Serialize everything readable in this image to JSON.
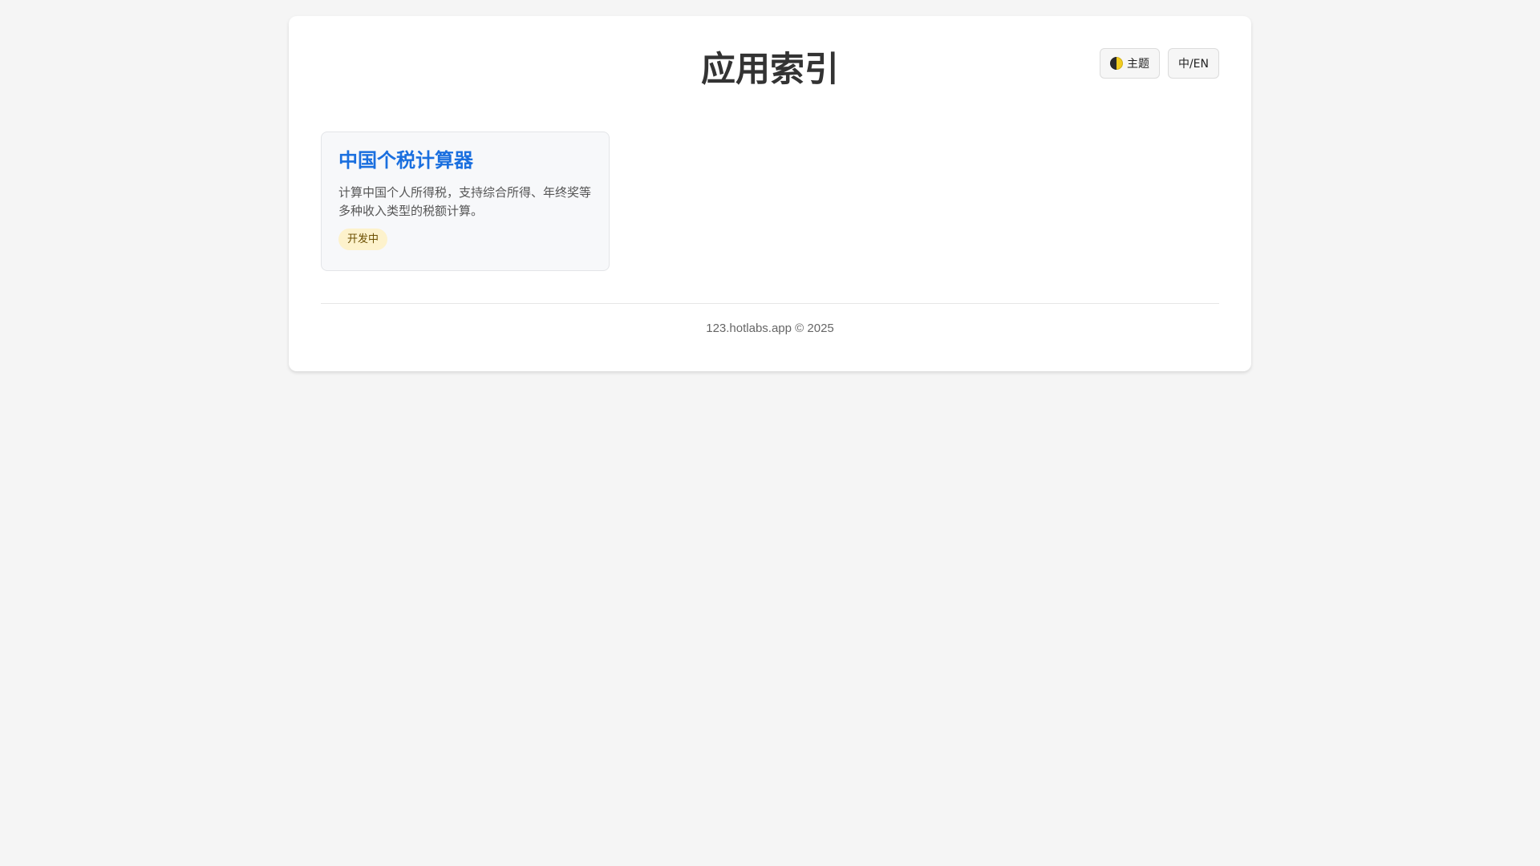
{
  "header": {
    "title": "应用索引",
    "theme_button_label": "主题",
    "theme_icon": "half-moon-icon",
    "lang_button_label": "中/EN"
  },
  "apps": [
    {
      "title": "中国个税计算器",
      "description": "计算中国个人所得税，支持综合所得、年终奖等多种收入类型的税额计算。",
      "status": "开发中"
    }
  ],
  "footer": {
    "text": "123.hotlabs.app © 2025"
  },
  "colors": {
    "page_background": "#f5f5f5",
    "card_background": "#ffffff",
    "app_title": "#1a6fdf",
    "badge_background": "#fdf2cc",
    "badge_text": "#6b4e00"
  }
}
